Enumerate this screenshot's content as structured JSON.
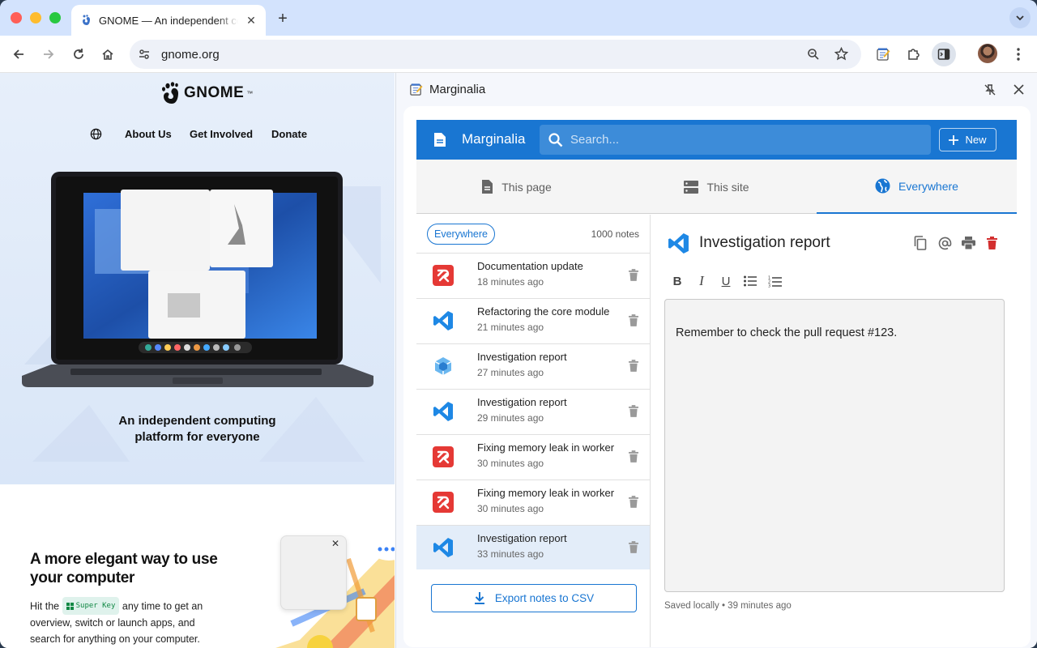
{
  "browser": {
    "tab_title": "GNOME — An independent computing platform for everyone",
    "url": "gnome.org"
  },
  "website": {
    "logo_text": "GNOME",
    "nav": [
      "About Us",
      "Get Involved",
      "Donate"
    ],
    "hero_title_line1": "An independent computing",
    "hero_title_line2": "platform for everyone",
    "section_title_line1": "A more elegant way to use",
    "section_title_line2": "your computer",
    "section_text_before": "Hit the",
    "super_key": "Super Key",
    "section_text_after": "any time to get an overview, switch or launch apps, and search for anything on your computer."
  },
  "side_panel": {
    "title": "Marginalia",
    "app_title": "Marginalia",
    "search_placeholder": "Search...",
    "new_label": "New",
    "tabs": [
      {
        "label": "This page",
        "icon": "page-icon"
      },
      {
        "label": "This site",
        "icon": "site-icon"
      },
      {
        "label": "Everywhere",
        "icon": "globe-icon",
        "active": true
      }
    ],
    "filter_chip": "Everywhere",
    "note_count": "1000 notes",
    "notes": [
      {
        "title": "Documentation update",
        "time": "18 minutes ago",
        "icon": "app-red-icon"
      },
      {
        "title": "Refactoring the core module",
        "time": "21 minutes ago",
        "icon": "vscode-icon"
      },
      {
        "title": "Investigation report",
        "time": "27 minutes ago",
        "icon": "cube-icon"
      },
      {
        "title": "Investigation report",
        "time": "29 minutes ago",
        "icon": "vscode-icon"
      },
      {
        "title": "Fixing memory leak in worker",
        "time": "30 minutes ago",
        "icon": "app-red-icon"
      },
      {
        "title": "Fixing memory leak in worker",
        "time": "30 minutes ago",
        "icon": "app-red-icon"
      },
      {
        "title": "Investigation report",
        "time": "33 minutes ago",
        "icon": "vscode-icon",
        "selected": true
      }
    ],
    "export_label": "Export notes to CSV",
    "detail": {
      "title": "Investigation report",
      "body": "Remember to check the pull request #123.",
      "status": "Saved locally • 39 minutes ago"
    },
    "colors": {
      "primary": "#1976d2",
      "danger": "#d32f2f",
      "red_app": "#e53935",
      "vscode": "#1e88e5"
    }
  }
}
